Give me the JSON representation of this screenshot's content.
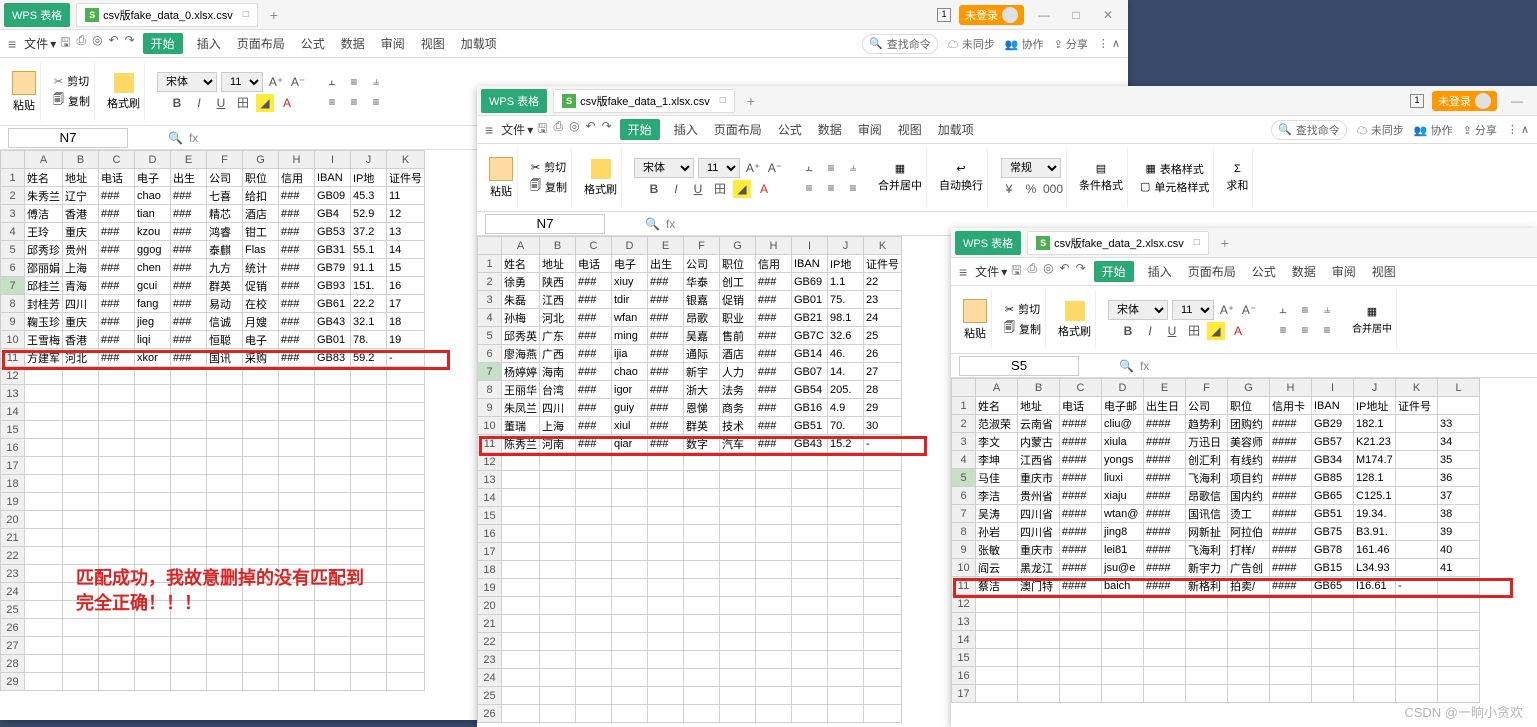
{
  "watermark": "CSDN @一晌小贪欢",
  "comment_l1": "匹配成功，我故意删掉的没有匹配到",
  "comment_l2": "完全正确！！！",
  "common": {
    "wps_label": "WPS 表格",
    "login": "未登录",
    "file_menu": "文件",
    "start": "开始",
    "insert": "插入",
    "layout": "页面布局",
    "formula": "公式",
    "data": "数据",
    "review": "审阅",
    "view": "视图",
    "load": "加载项",
    "search_ph": "查找命令",
    "nosync": "未同步",
    "collab": "协作",
    "share": "分享",
    "cut": "剪切",
    "copy": "复制",
    "brush": "格式刷",
    "paste": "粘贴",
    "font": "宋体",
    "size": "11",
    "mergecenter": "合并居中",
    "autowrap": "自动换行",
    "general": "常规",
    "condfmt": "条件格式",
    "tblstyle": "表格样式",
    "cellstyle": "单元格样式",
    "sum": "求和"
  },
  "w0": {
    "filename": "csv版fake_data_0.xlsx.csv",
    "cellref": "N7",
    "headers": [
      "A",
      "B",
      "C",
      "D",
      "E",
      "F",
      "G",
      "H",
      "I",
      "J",
      "K"
    ],
    "colhdr": [
      "姓名",
      "地址",
      "电话",
      "电子",
      "出生",
      "公司",
      "职位",
      "信用",
      "IBAN",
      "IP地",
      "证件号"
    ],
    "rows": [
      [
        "朱秀兰",
        "辽宁",
        "###",
        "chao",
        "###",
        "七喜",
        "给扣",
        "###",
        "GB09",
        "45.3",
        "11"
      ],
      [
        "傅洁",
        "香港",
        "###",
        "tian",
        "###",
        "精芯",
        "酒店",
        "###",
        "GB4",
        "52.9",
        "12"
      ],
      [
        "王玲",
        "重庆",
        "###",
        "kzou",
        "###",
        "鸿睿",
        "钳工",
        "###",
        "GB53",
        "37.2",
        "13"
      ],
      [
        "邱秀珍",
        "贵州",
        "###",
        "ggog",
        "###",
        "泰麒",
        "Flas",
        "###",
        "GB31",
        "55.1",
        "14"
      ],
      [
        "邵丽娟",
        "上海",
        "###",
        "chen",
        "###",
        "九方",
        "统计",
        "###",
        "GB79",
        "91.1",
        "15"
      ],
      [
        "邱桂兰",
        "青海",
        "###",
        "gcui",
        "###",
        "群英",
        "促销",
        "###",
        "GB93",
        "151.",
        "16"
      ],
      [
        "封桂芳",
        "四川",
        "###",
        "fang",
        "###",
        "易动",
        "在校",
        "###",
        "GB61",
        "22.2",
        "17"
      ],
      [
        "鞠玉珍",
        "重庆",
        "###",
        "jieg",
        "###",
        "信诚",
        "月嫂",
        "###",
        "GB43",
        "32.1",
        "18"
      ],
      [
        "王雪梅",
        "香港",
        "###",
        "liqi",
        "###",
        "恒聪",
        "电子",
        "###",
        "GB01",
        "78.",
        "19"
      ],
      [
        "方建军",
        "河北",
        "###",
        "xkor",
        "###",
        "国讯",
        "采购",
        "###",
        "GB83",
        "59.2",
        "-"
      ]
    ]
  },
  "w1": {
    "filename": "csv版fake_data_1.xlsx.csv",
    "cellref": "N7",
    "headers": [
      "A",
      "B",
      "C",
      "D",
      "E",
      "F",
      "G",
      "H",
      "I",
      "J",
      "K"
    ],
    "colhdr": [
      "姓名",
      "地址",
      "电话",
      "电子",
      "出生",
      "公司",
      "职位",
      "信用",
      "IBAN",
      "IP地",
      "证件号"
    ],
    "rows": [
      [
        "徐勇",
        "陕西",
        "###",
        "xiuy",
        "###",
        "华泰",
        "创工",
        "###",
        "GB69",
        "1.1",
        "22"
      ],
      [
        "朱磊",
        "江西",
        "###",
        "tdir",
        "###",
        "银嘉",
        "促销",
        "###",
        "GB01",
        "75.",
        "23"
      ],
      [
        "孙梅",
        "河北",
        "###",
        "wfan",
        "###",
        "昂歌",
        "职业",
        "###",
        "GB21",
        "98.1",
        "24"
      ],
      [
        "邱秀英",
        "广东",
        "###",
        "ming",
        "###",
        "吴嘉",
        "售前",
        "###",
        "GB7C",
        "32.6",
        "25"
      ],
      [
        "廖海燕",
        "广西",
        "###",
        "ijia",
        "###",
        "通际",
        "酒店",
        "###",
        "GB14",
        "46.",
        "26"
      ],
      [
        "杨婷婷",
        "海南",
        "###",
        "chao",
        "###",
        "新宇",
        "人力",
        "###",
        "GB07",
        "14.",
        "27"
      ],
      [
        "王丽华",
        "台湾",
        "###",
        "igor",
        "###",
        "浙大",
        "法务",
        "###",
        "GB54",
        "205.",
        "28"
      ],
      [
        "朱凤兰",
        "四川",
        "###",
        "guiy",
        "###",
        "恩悌",
        "商务",
        "###",
        "GB16",
        "4.9",
        "29"
      ],
      [
        "董瑞",
        "上海",
        "###",
        "xiul",
        "###",
        "群英",
        "技术",
        "###",
        "GB51",
        "70.",
        "30"
      ],
      [
        "陈秀兰",
        "河南",
        "###",
        "qiar",
        "###",
        "数字",
        "汽车",
        "###",
        "GB43",
        "15.2",
        "-"
      ]
    ]
  },
  "w2": {
    "filename": "csv版fake_data_2.xlsx.csv",
    "cellref": "S5",
    "headers": [
      "A",
      "B",
      "C",
      "D",
      "E",
      "F",
      "G",
      "H",
      "I",
      "J",
      "K",
      "L"
    ],
    "colhdr": [
      "姓名",
      "地址",
      "电话",
      "电子邮",
      "出生日",
      "公司",
      "职位",
      "信用卡",
      "IBAN",
      "IP地址",
      "证件号",
      ""
    ],
    "rows": [
      [
        "范淑荣",
        "云南省",
        "####",
        "cliu@",
        "####",
        "趋势利",
        "团购约",
        "####",
        "GB29",
        "182.1",
        "",
        "33"
      ],
      [
        "李文",
        "内蒙古",
        "####",
        "xiula",
        "####",
        "万迅日",
        "美容师",
        "####",
        "GB57",
        "K21.23",
        "",
        "34"
      ],
      [
        "李坤",
        "江西省",
        "####",
        "yongs",
        "####",
        "创汇利",
        "有线约",
        "####",
        "GB34",
        "M174.7",
        "",
        "35"
      ],
      [
        "马佳",
        "重庆市",
        "####",
        "liuxi",
        "####",
        "飞海利",
        "项目约",
        "####",
        "GB85",
        "128.1",
        "",
        "36"
      ],
      [
        "李洁",
        "贵州省",
        "####",
        "xiaju",
        "####",
        "昂歌信",
        "国内约",
        "####",
        "GB65",
        "C125.1",
        "",
        "37"
      ],
      [
        "吴涛",
        "四川省",
        "####",
        "wtan@",
        "####",
        "国讯信",
        "烫工",
        "####",
        "GB51",
        "19.34.",
        "",
        "38"
      ],
      [
        "孙岩",
        "四川省",
        "####",
        "jing8",
        "####",
        "网新扯",
        "阿拉伯",
        "####",
        "GB75",
        "B3.91.",
        "",
        "39"
      ],
      [
        "张敏",
        "重庆市",
        "####",
        "lei81",
        "####",
        "飞海利",
        "打样/",
        "####",
        "GB78",
        "161.46",
        "",
        "40"
      ],
      [
        "阎云",
        "黑龙江",
        "####",
        "jsu@e",
        "####",
        "新宇力",
        "广告创",
        "####",
        "GB15",
        "L34.93",
        "",
        "41"
      ],
      [
        "蔡洁",
        "澳门特",
        "####",
        "baich",
        "####",
        "新格利",
        "拍卖/",
        "####",
        "GB65",
        "I16.61",
        "-",
        ""
      ]
    ]
  }
}
